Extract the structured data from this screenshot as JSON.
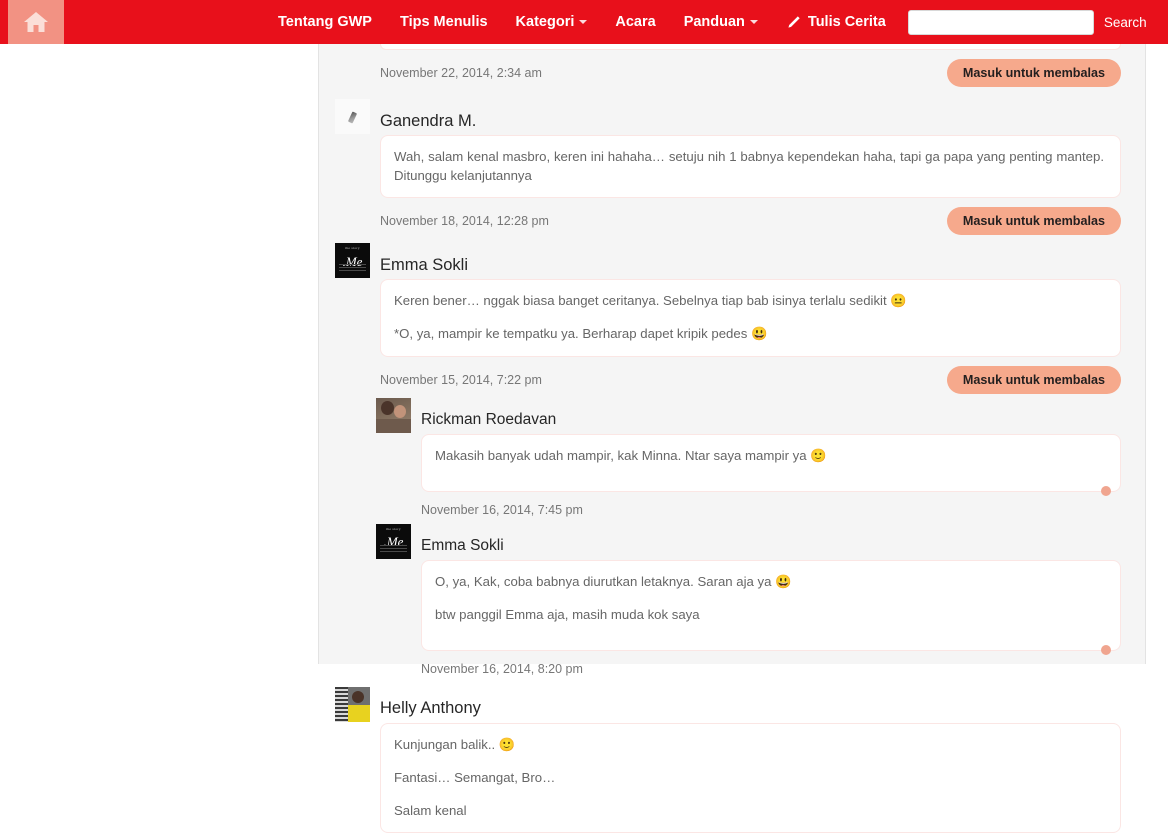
{
  "nav": {
    "home_label": "Home",
    "items": [
      {
        "label": "Tentang GWP",
        "caret": false,
        "icon": null
      },
      {
        "label": "Tips Menulis",
        "caret": false,
        "icon": null
      },
      {
        "label": "Kategori",
        "caret": true,
        "icon": null
      },
      {
        "label": "Acara",
        "caret": false,
        "icon": null
      },
      {
        "label": "Panduan",
        "caret": true,
        "icon": null
      },
      {
        "label": "Tulis Cerita",
        "caret": false,
        "icon": "pencil-icon"
      }
    ],
    "search": {
      "value": "",
      "placeholder": "",
      "button_label": "Search"
    },
    "brand_color": "#e8101b",
    "home_bg": "#f29283"
  },
  "comments": {
    "reply_button_label": "Masuk untuk membalas",
    "top_partial_timestamp": "November 22, 2014, 2:34 am",
    "items": [
      {
        "author": "Ganendra M.",
        "avatar": "av-ganendra",
        "depth": 0,
        "paragraphs": [
          "Wah, salam kenal masbro, keren ini hahaha… setuju nih 1 babnya kependekan haha, tapi ga papa yang penting mantep. Ditunggu kelanjutannya"
        ],
        "timestamp": "November 18, 2014, 12:28 pm",
        "has_reply_button": true,
        "has_dot": false
      },
      {
        "author": "Emma Sokli",
        "avatar": "av-me",
        "depth": 0,
        "paragraphs": [
          "Keren bener… nggak biasa banget ceritanya. Sebelnya tiap bab isinya terlalu sedikit 😐",
          "*O, ya, mampir ke tempatku ya. Berharap dapet kripik pedes 😃"
        ],
        "timestamp": "November 15, 2014, 7:22 pm",
        "has_reply_button": true,
        "has_dot": false
      },
      {
        "author": "Rickman Roedavan",
        "avatar": "av-rickman",
        "depth": 1,
        "paragraphs": [
          "Makasih banyak udah mampir, kak Minna. Ntar saya mampir ya 🙂"
        ],
        "timestamp": "November 16, 2014, 7:45 pm",
        "has_reply_button": false,
        "has_dot": true
      },
      {
        "author": "Emma Sokli",
        "avatar": "av-me",
        "depth": 1,
        "paragraphs": [
          "O, ya, Kak, coba babnya diurutkan letaknya. Saran aja ya 😃",
          "btw panggil Emma aja, masih muda kok saya"
        ],
        "timestamp": "November 16, 2014, 8:20 pm",
        "has_reply_button": false,
        "has_dot": true
      },
      {
        "author": "Helly Anthony",
        "avatar": "av-helly",
        "depth": 0,
        "paragraphs": [
          "Kunjungan balik.. 🙂",
          "Fantasi… Semangat, Bro…",
          "Salam kenal"
        ],
        "timestamp": "",
        "has_reply_button": false,
        "has_dot": false
      }
    ]
  }
}
